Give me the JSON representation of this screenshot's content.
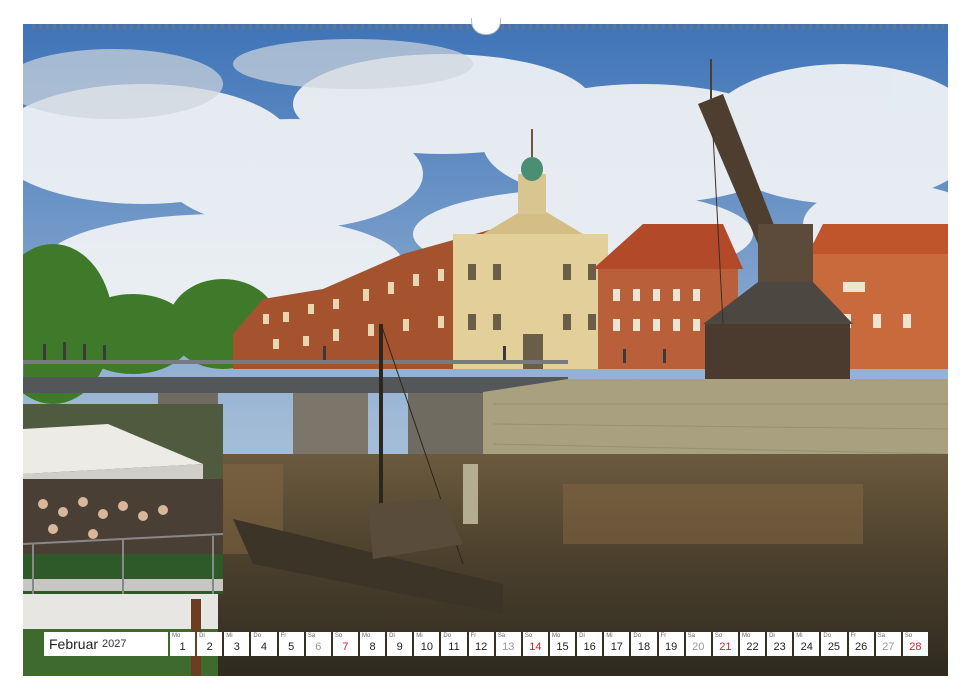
{
  "calendar": {
    "month": "Februar",
    "year": "2027",
    "days": [
      {
        "wd": "Mo",
        "num": "1",
        "type": "weekday"
      },
      {
        "wd": "Di",
        "num": "2",
        "type": "weekday"
      },
      {
        "wd": "Mi",
        "num": "3",
        "type": "weekday"
      },
      {
        "wd": "Do",
        "num": "4",
        "type": "weekday"
      },
      {
        "wd": "Fr",
        "num": "5",
        "type": "weekday"
      },
      {
        "wd": "Sa",
        "num": "6",
        "type": "weekend"
      },
      {
        "wd": "So",
        "num": "7",
        "type": "sunday"
      },
      {
        "wd": "Mo",
        "num": "8",
        "type": "weekday"
      },
      {
        "wd": "Di",
        "num": "9",
        "type": "weekday"
      },
      {
        "wd": "Mi",
        "num": "10",
        "type": "weekday"
      },
      {
        "wd": "Do",
        "num": "11",
        "type": "weekday"
      },
      {
        "wd": "Fr",
        "num": "12",
        "type": "weekday"
      },
      {
        "wd": "Sa",
        "num": "13",
        "type": "weekend"
      },
      {
        "wd": "So",
        "num": "14",
        "type": "sunday"
      },
      {
        "wd": "Mo",
        "num": "15",
        "type": "weekday"
      },
      {
        "wd": "Di",
        "num": "16",
        "type": "weekday"
      },
      {
        "wd": "Mi",
        "num": "17",
        "type": "weekday"
      },
      {
        "wd": "Do",
        "num": "18",
        "type": "weekday"
      },
      {
        "wd": "Fr",
        "num": "19",
        "type": "weekday"
      },
      {
        "wd": "Sa",
        "num": "20",
        "type": "weekend"
      },
      {
        "wd": "So",
        "num": "21",
        "type": "sunday"
      },
      {
        "wd": "Mo",
        "num": "22",
        "type": "weekday"
      },
      {
        "wd": "Di",
        "num": "23",
        "type": "weekday"
      },
      {
        "wd": "Mi",
        "num": "24",
        "type": "weekday"
      },
      {
        "wd": "Do",
        "num": "25",
        "type": "weekday"
      },
      {
        "wd": "Fr",
        "num": "26",
        "type": "weekday"
      },
      {
        "wd": "Sa",
        "num": "27",
        "type": "weekend"
      },
      {
        "wd": "So",
        "num": "28",
        "type": "sunday"
      }
    ]
  },
  "colors": {
    "sunday": "#d4202a",
    "weekend": "#999999"
  }
}
